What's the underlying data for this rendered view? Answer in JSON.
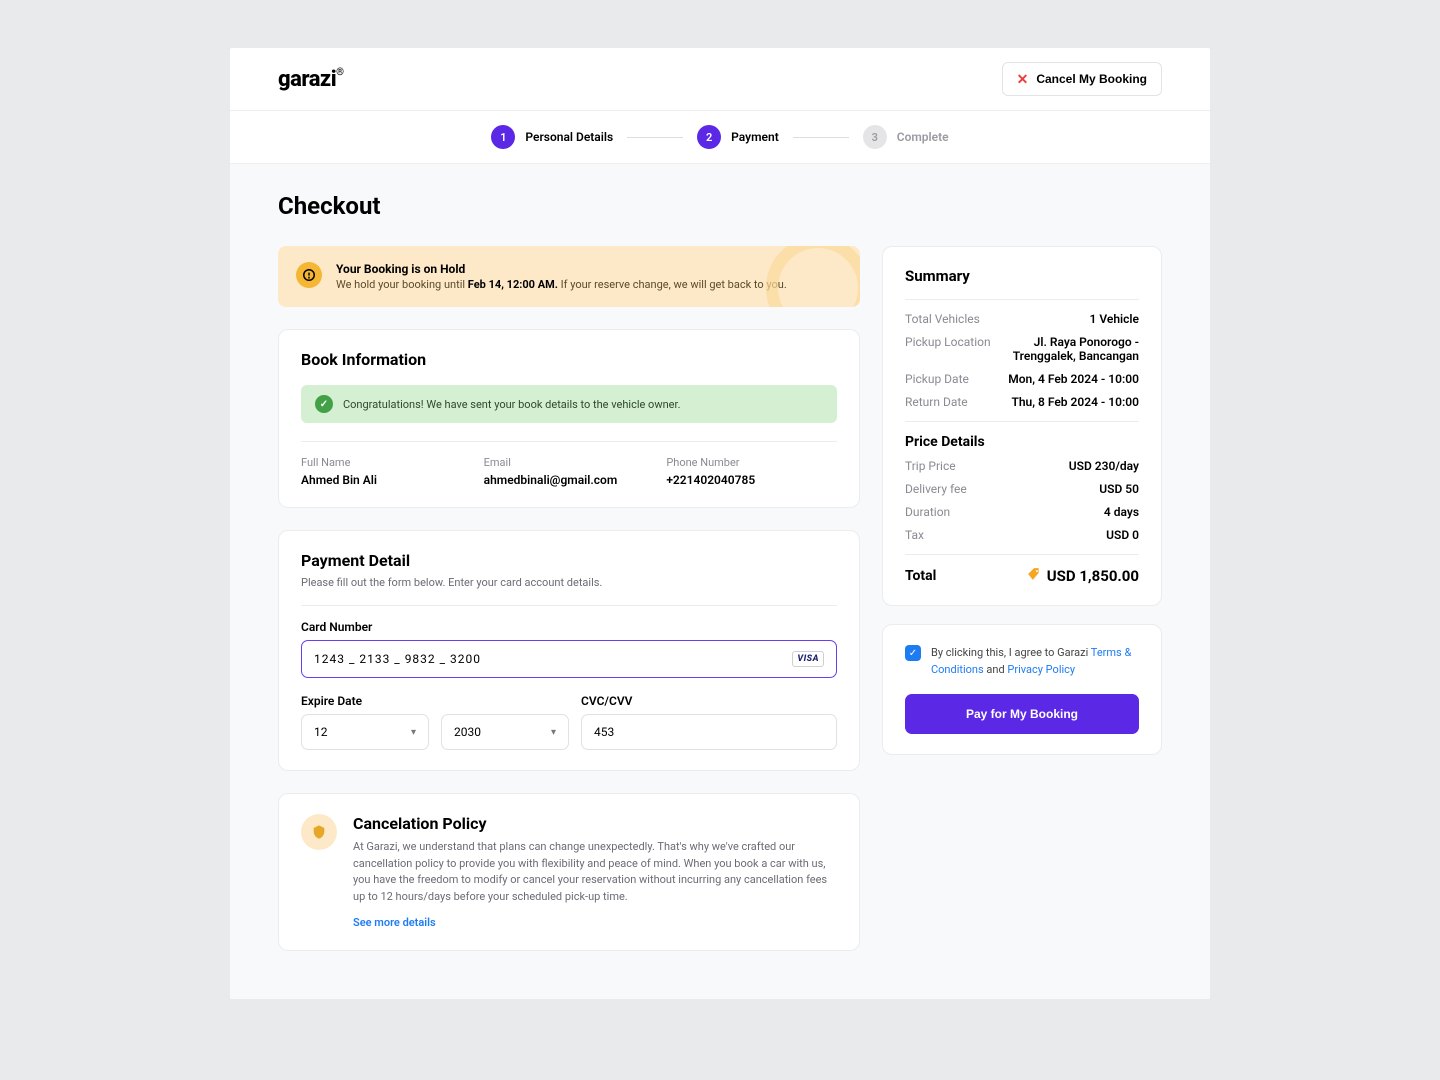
{
  "brand": {
    "name": "garazi",
    "mark": "®"
  },
  "header": {
    "cancel_label": "Cancel My Booking"
  },
  "stepper": {
    "steps": [
      {
        "num": "1",
        "label": "Personal Details"
      },
      {
        "num": "2",
        "label": "Payment"
      },
      {
        "num": "3",
        "label": "Complete"
      }
    ]
  },
  "page_title": "Checkout",
  "hold_alert": {
    "title": "Your Booking is on Hold",
    "body_prefix": "We hold your booking until ",
    "body_bold": "Feb 14, 12:00 AM.",
    "body_suffix": " If your reserve change, we will get back to you."
  },
  "book_info": {
    "heading": "Book Information",
    "success_msg": "Congratulations! We have sent your book details to the vehicle owner.",
    "full_name_label": "Full Name",
    "full_name_value": "Ahmed Bin Ali",
    "email_label": "Email",
    "email_value": "ahmedbinali@gmail.com",
    "phone_label": "Phone Number",
    "phone_value": "+221402040785"
  },
  "payment": {
    "heading": "Payment Detail",
    "subtext": "Please fill out the form below. Enter your card account details.",
    "card_label": "Card Number",
    "card_value": "1243 _ 2133 _ 9832 _ 3200",
    "card_brand": "VISA",
    "expire_label": "Expire Date",
    "expire_month": "12",
    "expire_year": "2030",
    "cvc_label": "CVC/CVV",
    "cvc_value": "453"
  },
  "cancel_policy": {
    "heading": "Cancelation Policy",
    "text": "At Garazi, we understand that plans can change unexpectedly. That's why we've crafted our cancellation policy to provide you with flexibility and peace of mind. When you book a car with us, you have the freedom to modify or cancel your reservation without incurring any cancellation fees up to 12 hours/days before your scheduled pick-up time.",
    "link": "See more details"
  },
  "summary": {
    "heading": "Summary",
    "rows": [
      {
        "label": "Total Vehicles",
        "value": "1 Vehicle"
      },
      {
        "label": "Pickup Location",
        "value": "Jl. Raya Ponorogo - Trenggalek, Bancangan"
      },
      {
        "label": "Pickup Date",
        "value": "Mon, 4 Feb 2024 - 10:00"
      },
      {
        "label": "Return Date",
        "value": "Thu, 8 Feb 2024 - 10:00"
      }
    ],
    "price_heading": "Price Details",
    "price_rows": [
      {
        "label": "Trip Price",
        "value": "USD 230/day"
      },
      {
        "label": "Delivery fee",
        "value": "USD 50"
      },
      {
        "label": "Duration",
        "value": "4 days"
      },
      {
        "label": "Tax",
        "value": "USD 0"
      }
    ],
    "total_label": "Total",
    "total_value": "USD 1,850.00"
  },
  "agree": {
    "text_prefix": "By clicking this, I agree to Garazi ",
    "terms_link": "Terms & Conditions",
    "and_text": " and ",
    "privacy_link": "Privacy Policy"
  },
  "pay_button": "Pay for My Booking"
}
